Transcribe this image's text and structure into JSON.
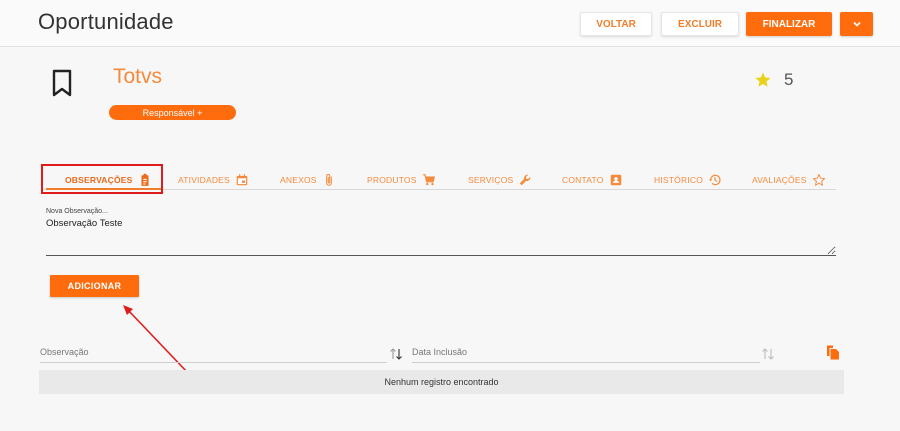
{
  "header": {
    "title": "Oportunidade",
    "back_label": "VOLTAR",
    "delete_label": "EXCLUIR",
    "finish_label": "FINALIZAR"
  },
  "opportunity": {
    "name": "Totvs",
    "responsible_label": "Responsável +",
    "rating": "5"
  },
  "tabs": [
    {
      "label": "OBSERVAÇÕES",
      "icon": "clipboard-icon"
    },
    {
      "label": "ATIVIDADES",
      "icon": "calendar-icon"
    },
    {
      "label": "ANEXOS",
      "icon": "paperclip-icon"
    },
    {
      "label": "PRODUTOS",
      "icon": "cart-icon"
    },
    {
      "label": "SERVIÇOS",
      "icon": "wrench-icon"
    },
    {
      "label": "CONTATO",
      "icon": "contact-card-icon"
    },
    {
      "label": "HISTÓRICO",
      "icon": "history-icon"
    },
    {
      "label": "AVALIAÇÕES",
      "icon": "star-outline-icon"
    }
  ],
  "observation": {
    "label": "Nova Observação...",
    "value": "Observação Teste"
  },
  "add_label": "ADICIONAR",
  "table": {
    "columns": [
      "Observação",
      "Data Inclusão"
    ],
    "empty_message": "Nenhum registro encontrado"
  },
  "colors": {
    "accent": "#ff6c0e",
    "annotation": "#e01b1b",
    "star": "#e8d21a"
  }
}
